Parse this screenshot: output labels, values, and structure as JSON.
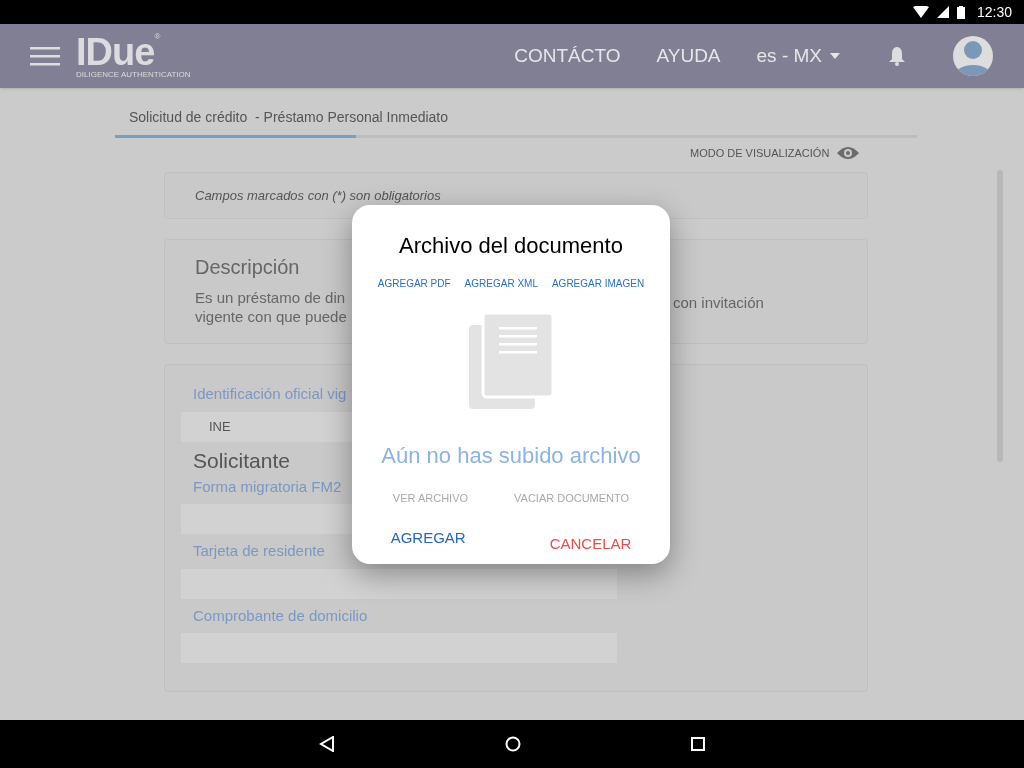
{
  "status_bar": {
    "time": "12:30"
  },
  "header": {
    "logo": "IDue",
    "logo_mark": "®",
    "logo_tagline": "DILIGENCE AUTHENTICATION",
    "links": [
      "CONTÁCTO",
      "AYUDA"
    ],
    "language": "es - MX"
  },
  "breadcrumb": {
    "title": "Solicitud de crédito  - Préstamo Personal Inmediato",
    "level": 0.3
  },
  "view_mode": "MODO DE VISUALIZACIÓN",
  "notice": "Campos marcados con (*) son obligatorios",
  "description": {
    "title": "Descripción",
    "lines_left": [
      "Es un préstamo de din",
      "vigente con que puede"
    ],
    "line_right": "con invitación"
  },
  "documents": {
    "fields": [
      {
        "label": "Identificación oficial vig",
        "value": "INE"
      }
    ],
    "section": "Solicitante",
    "fields_2": [
      {
        "label": "Forma migratoria FM2"
      },
      {
        "label": "Tarjeta de residente"
      },
      {
        "label": "Comprobante de domicilio"
      }
    ]
  },
  "dialog": {
    "title": "Archivo del documento",
    "add_options": [
      "AGREGAR PDF",
      "AGREGAR XML",
      "AGREGAR IMAGEN"
    ],
    "empty_message": "Aún no has subido archivo",
    "file_actions": [
      {
        "label": "VER ARCHIVO",
        "disabled": true
      },
      {
        "label": "VACIAR DOCUMENTO",
        "disabled": true
      }
    ],
    "buttons": [
      {
        "label": "AGREGAR",
        "kind": "primary"
      },
      {
        "label": "CANCELAR",
        "kind": "cancel"
      }
    ]
  }
}
